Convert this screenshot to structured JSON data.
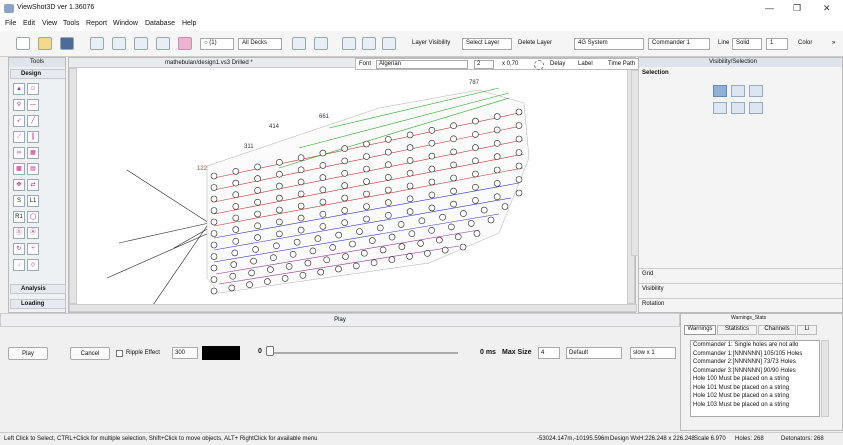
{
  "window": {
    "title": "ViewShot3D ver 1.36076",
    "min": "—",
    "max": "❐",
    "close": "✕"
  },
  "menu": [
    "File",
    "Edit",
    "View",
    "Tools",
    "Report",
    "Window",
    "Database",
    "Help"
  ],
  "toolbar": {
    "hole_select": "○ (1)",
    "decks": "All Decks",
    "layer_visibility": "Layer Visibility",
    "select_layer": "Select Layer",
    "delete_layer": "Delete Layer",
    "system": "4G System",
    "commander": "Commander 1",
    "line_label": "Line",
    "line_style": "Solid",
    "line_width": "1",
    "color_label": "Color",
    "overflow": "»"
  },
  "left_panel": {
    "header": "Tools",
    "design": "Design",
    "analysis": "Analysis",
    "loading": "Loading",
    "tool_s": "S",
    "tool_l1": "L1",
    "tool_r1": "R1"
  },
  "document": {
    "title": "mathebulan/design1.vs3 Drilled *"
  },
  "fontbar": {
    "font_label": "Font",
    "font": "Algerian",
    "size": "2",
    "scale": "x 0,70",
    "delay": "Delay",
    "label": "Label",
    "time_path": "Time Path"
  },
  "right_panel": {
    "header": "Visibility/Selection",
    "selection": "Selection",
    "grid": "Grid",
    "visibility": "Visibility",
    "rotation": "Rotation"
  },
  "play": {
    "header": "Play",
    "play_btn": "Play",
    "cancel_btn": "Cancel",
    "ripple": "Ripple Effect",
    "ripple_value": "300",
    "time_value": "0",
    "ms_label": "0 ms",
    "max_size_label": "Max Size",
    "max_size": "4",
    "preset": "Default",
    "speed": "slow x 1"
  },
  "warnings": {
    "header": "Warnings_Stats",
    "tabs": [
      "Warnings",
      "Statistics",
      "Channels",
      "Li"
    ],
    "items": [
      "Commander 1: Single holes are not allo",
      "Commander 1:[NNNNNN] 105/105 Holes",
      "Commander 2:[NNNNNN] 73/73 Holes",
      "Commander 3:[NNNNNN] 90/90 Holes",
      "Hole 100 Must be placed on a string",
      "Hole 101 Must be placed on a string",
      "Hole 102 Must be placed on a string",
      "Hole 103 Must be placed on a string"
    ]
  },
  "status": {
    "hint": "Left Click to Select, CTRL+Click for multiple selection, Shift+Click to move objects, ALT+ RightClick for available menu",
    "coords": "-53024.147m,-10195.596m",
    "design": "Design WxH:226.248 x 226.248",
    "scale": "Scale 6.970",
    "holes": "Holes: 268",
    "detonators": "Detonators: 268"
  },
  "canvas_labels": {
    "top": "787",
    "l1": "414",
    "l2": "311",
    "l3": "122",
    "l4": "661"
  }
}
